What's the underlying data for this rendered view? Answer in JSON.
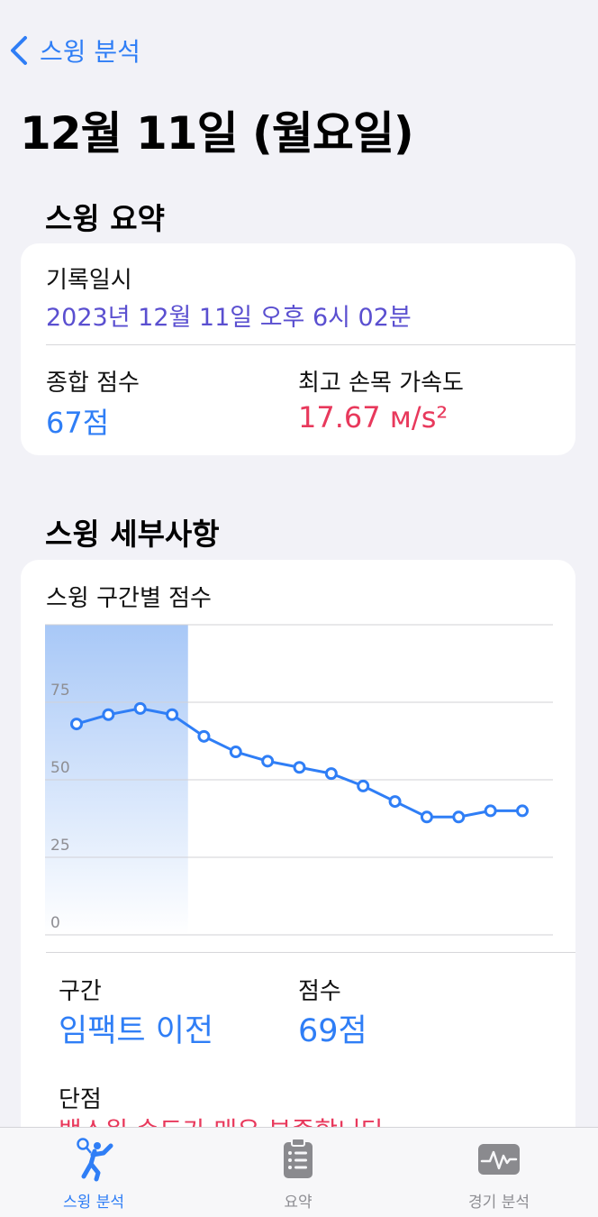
{
  "nav": {
    "back_label": "스윙 분석"
  },
  "page": {
    "title": "12월 11일 (월요일)"
  },
  "summary": {
    "section_title": "스윙 요약",
    "record_label": "기록일시",
    "record_value": "2023년 12월 11일 오후 6시 02분",
    "score_label": "종합 점수",
    "score_value": "67점",
    "accel_label": "최고 손목 가속도",
    "accel_value": "17.67 ᴍ/s²"
  },
  "details": {
    "section_title": "스윙 세부사항",
    "chart_title": "스윙 구간별 점수",
    "segment_label": "구간",
    "segment_value": "임팩트 이전",
    "points_label": "점수",
    "points_value": "69점",
    "weakness_label": "단점",
    "weakness_value": "백스윙 속도가 매우 부족합니다"
  },
  "chart_data": {
    "type": "line",
    "title": "스윙 구간별 점수",
    "y_ticks": [
      0,
      25,
      50,
      75
    ],
    "ylim": [
      0,
      100
    ],
    "x": [
      1,
      2,
      3,
      4,
      5,
      6,
      7,
      8,
      9,
      10,
      11,
      12,
      13,
      14,
      15
    ],
    "values": [
      68,
      71,
      73,
      71,
      64,
      59,
      56,
      54,
      52,
      48,
      43,
      38,
      38,
      40,
      40
    ],
    "highlight_range": [
      1,
      4
    ],
    "grid": true,
    "line_color": "#2f7ef6"
  },
  "tabs": [
    {
      "label": "스윙 분석",
      "icon": "badminton-player-icon",
      "active": true
    },
    {
      "label": "요약",
      "icon": "clipboard-icon",
      "active": false
    },
    {
      "label": "경기 분석",
      "icon": "waveform-icon",
      "active": false
    }
  ],
  "colors": {
    "accent": "#2f7ef6",
    "date": "#5a4fd0",
    "danger": "#e8395c"
  }
}
